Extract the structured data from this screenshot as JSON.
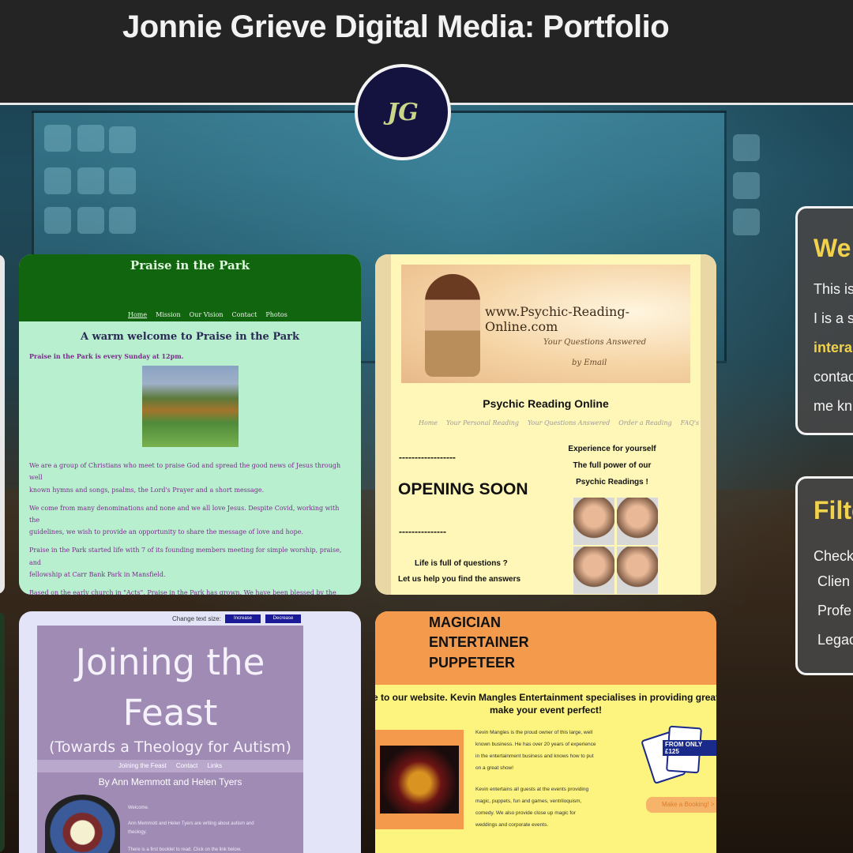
{
  "header": {
    "title": "Jonnie Grieve Digital Media: Portfolio",
    "logo_text": "JG"
  },
  "card_praise": {
    "title": "Praise in the Park",
    "nav": [
      "Home",
      "Mission",
      "Our Vision",
      "Contact",
      "Photos"
    ],
    "heading": "A warm welcome to Praise in the Park",
    "when": "Praise in the Park is every Sunday at 12pm.",
    "p1": "We are a group of Christians who meet to praise God and spread the good news of Jesus through well",
    "p1b": "known hymns and songs, psalms, the Lord's Prayer and a short message.",
    "p2": "We come from many denominations and none and we all love Jesus. Despite Covid, working with the",
    "p2b": "guidelines, we wish to provide an opportunity to share the message of love and hope.",
    "p3": "Praise in the Park started life with 7 of its founding members meeting for simple worship, praise, and",
    "p3b": "fellowship at Carr Bank Park in Mansfield.",
    "p4": "Based on the early church in \"Acts\", Praise in the Park has grown. We have been blessed by the Lord as"
  },
  "card_psychic": {
    "url": "www.Psychic-Reading-Online.com",
    "sub1": "Your Questions Answered",
    "sub2": "by Email",
    "title": "Psychic Reading Online",
    "nav": [
      "Home",
      "Your Personal Reading",
      "Your Questions Answered",
      "Order a Reading",
      "FAQ's"
    ],
    "dash1": "------------------",
    "soon": "OPENING SOON",
    "dash2": "---------------",
    "exp1": "Experience for yourself",
    "exp2": "The full power of our",
    "exp3": "Psychic Readings !",
    "life": "Life is full of questions ?",
    "help": "Let us help you find the answers"
  },
  "card_feast": {
    "text_size": "Change text size:",
    "increase": "Increase",
    "decrease": "Decrease",
    "t1": "Joining the",
    "t2": "Feast",
    "t3": "(Towards a Theology for Autism)",
    "nav": [
      "Joining the Feast",
      "Contact",
      "Links"
    ],
    "authors": "By Ann Memmott and Helen Tyers",
    "w": "Welcome.",
    "w2": "Ann Memmott and Helen Tyers are writing about autism and",
    "w3": "theology.",
    "w4": "There is a first booklet to read. Click on the link below."
  },
  "card_magician": {
    "l1": "MAGICIAN",
    "l2": "ENTERTAINER",
    "l3": "PUPPETEER",
    "welcome": "e to our website. Kevin Mangles Entertainment specialises in providing great entertai",
    "perfect": "make your event perfect!",
    "m1": "Kevin Mangles is the proud owner of this large, well",
    "m2": "known business. He has over 20 years of experience",
    "m3": "in the entertainment business and knows how to put",
    "m4": "on a great show!",
    "m5": "Kevin entertains all guests at the events providing",
    "m6": "magic, puppets, fun and games, ventriloquism,",
    "m7": "comedy. We also provide close up magic for",
    "m8": "weddings and corporate events.",
    "from": "FROM ONLY",
    "price": "£125",
    "booking": "Make a Booking! >"
  },
  "panel_welcome": {
    "heading": "We",
    "l1": "This is",
    "l2": "I is a se",
    "l3": "intera",
    "l4": "contac",
    "l5": "me kn"
  },
  "panel_filter": {
    "heading": "Filte",
    "l1": "Check",
    "l2": "Clien",
    "l3": "Profe",
    "l4": "Legac"
  }
}
